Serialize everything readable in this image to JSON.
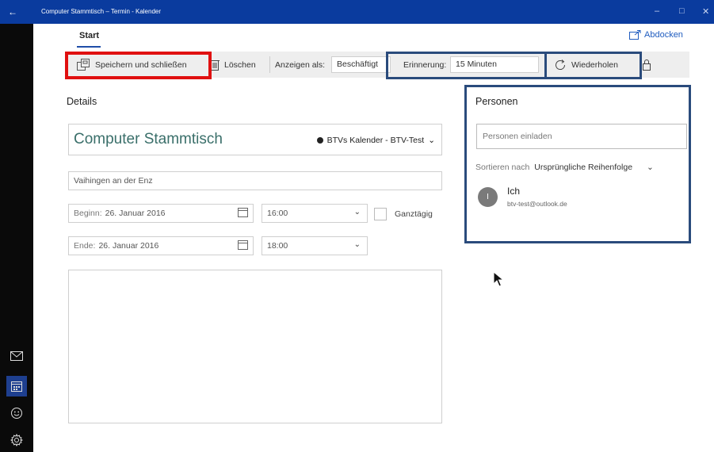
{
  "window": {
    "title": "Computer Stammtisch – Termin - Kalender",
    "back_glyph": "←",
    "min_glyph": "–",
    "max_glyph": "□",
    "close_glyph": "✕"
  },
  "rail": {
    "items": [
      "mail-icon",
      "calendar-icon",
      "feedback-smiley-icon",
      "settings-gear-icon"
    ]
  },
  "header": {
    "tab_start": "Start",
    "detach_label": "Abdocken"
  },
  "toolbar": {
    "save_close_label": "Speichern und schließen",
    "delete_label": "Löschen",
    "show_as_label": "Anzeigen als:",
    "show_as_value": "Beschäftigt",
    "reminder_label": "Erinnerung:",
    "reminder_value": "15 Minuten",
    "repeat_label": "Wiederholen"
  },
  "details": {
    "heading": "Details",
    "subject": "Computer Stammtisch",
    "calendar": "BTVs Kalender - BTV-Test",
    "location": "Vaihingen an der Enz",
    "start_label": "Beginn:",
    "start_date": "26. Januar 2016",
    "start_time": "16:00",
    "all_day_label": "Ganztägig",
    "end_label": "Ende:",
    "end_date": "26. Januar 2016",
    "end_time": "18:00"
  },
  "people": {
    "heading": "Personen",
    "invite_placeholder": "Personen einladen",
    "sort_label": "Sortieren nach",
    "sort_value": "Ursprüngliche Reihenfolge",
    "attendees": [
      {
        "initial": "I",
        "name": "Ich",
        "email": "btv-test@outlook.de"
      }
    ]
  },
  "colors": {
    "highlight_red": "#e01010",
    "highlight_blue": "#2a4b7c",
    "accent": "#1f4ea8"
  }
}
